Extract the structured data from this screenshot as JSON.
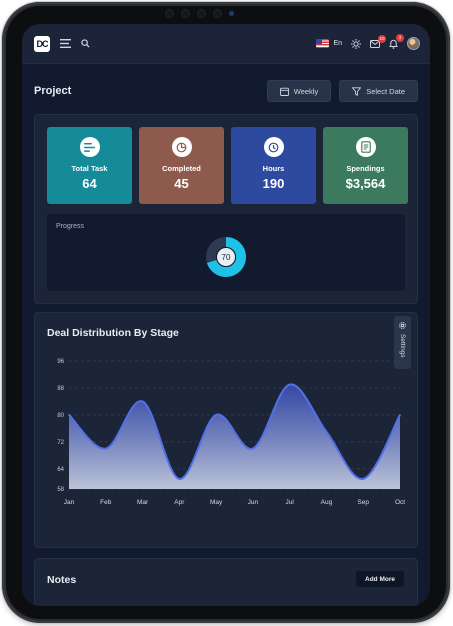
{
  "header": {
    "logo_text": "DC",
    "language": "En",
    "mail_count": "10",
    "notification_count": "3"
  },
  "page": {
    "title": "Project",
    "weekly_label": "Weekly",
    "select_date_label": "Select Date"
  },
  "stats": [
    {
      "label": "Total Task",
      "value": "64",
      "color": "#158a99",
      "icon": "list-icon"
    },
    {
      "label": "Completed",
      "value": "45",
      "color": "#8e5a4e",
      "icon": "pie-icon"
    },
    {
      "label": "Hours",
      "value": "190",
      "color": "#2d4aa0",
      "icon": "clock-icon"
    },
    {
      "label": "Spendings",
      "value": "$3,564",
      "color": "#3c7a5f",
      "icon": "receipt-icon"
    }
  ],
  "progress": {
    "label": "Progress",
    "value": 70,
    "center_text": "70",
    "colors": {
      "filled": "#1fc2e6",
      "rest": "#2d3a52"
    }
  },
  "deal": {
    "title": "Deal Distribution By Stage",
    "settings_label": "Settings"
  },
  "chart_data": {
    "type": "area",
    "title": "Deal Distribution By Stage",
    "x": [
      "Jan",
      "Feb",
      "Mar",
      "Apr",
      "May",
      "Jun",
      "Jul",
      "Aug",
      "Sep",
      "Oct"
    ],
    "series": [
      {
        "values": [
          80,
          70,
          84,
          61,
          80,
          70,
          89,
          75,
          61,
          80
        ]
      }
    ],
    "yticks": [
      58,
      64,
      72,
      80,
      88,
      96
    ],
    "ylim": [
      58,
      96
    ],
    "grid": true,
    "line_color": "#5470e8"
  },
  "notes": {
    "title": "Notes",
    "add_label": "Add More"
  }
}
